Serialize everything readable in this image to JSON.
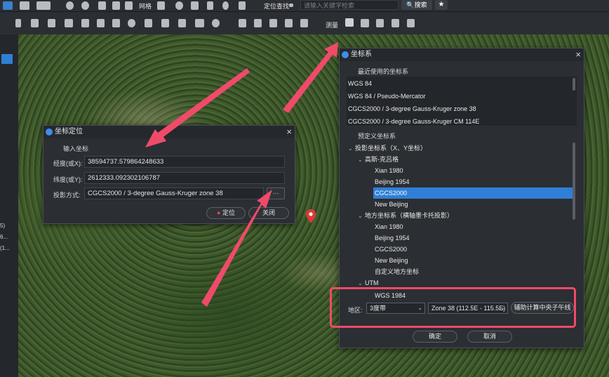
{
  "toolbar": {
    "grid_label": "网格",
    "locate_search_label": "定位查找",
    "search_placeholder": "请输入关键字检索",
    "search_button": "搜索",
    "measure_label": "测量",
    "star_button": "★"
  },
  "left_panel": {
    "labels": [
      "5)",
      "6...",
      "(1..."
    ]
  },
  "coord_locate_dialog": {
    "title": "坐标定位",
    "section_title": "输入坐标",
    "longitude_label": "经度(或X):",
    "longitude_value": "38594737.579864248633",
    "latitude_label": "纬度(或Y):",
    "latitude_value": "2612333.092302106787",
    "projection_label": "投影方式:",
    "projection_value": "CGCS2000 / 3-degree Gauss-Kruger zone 38",
    "browse_button": "···",
    "locate_button": "定位",
    "close_button": "关闭"
  },
  "crs_dialog": {
    "title": "坐标系",
    "recent_header": "最近使用的坐标系",
    "recent_items": [
      "WGS 84",
      "WGS 84 / Pseudo-Mercator",
      "CGCS2000 / 3-degree Gauss-Kruger zone 38",
      "CGCS2000 / 3-degree Gauss-Kruger CM 114E"
    ],
    "predefined_header": "预定义坐标系",
    "tree": {
      "projected": "投影坐标系（X、Y坐标）",
      "gauss": "高斯-克吕格",
      "gauss_children": [
        "Xian 1980",
        "Beijing 1954",
        "CGCS2000",
        "New Beijing"
      ],
      "gauss_selected": "CGCS2000",
      "local": "地方坐标系（横轴墨卡托投影）",
      "local_children": [
        "Xian 1980",
        "Beijing 1954",
        "CGCS2000",
        "New Beijing",
        "自定义地方坐标"
      ],
      "utm": "UTM",
      "utm_child": "WGS 1984"
    },
    "region_label": "地区:",
    "band_value": "3度带",
    "zone_value": "Zone 38 (112.5E - 115.5E)",
    "calc_button": "辅助计算中央子午线",
    "ok_button": "确定",
    "cancel_button": "取消"
  },
  "colors": {
    "accent": "#2f7fd6",
    "annotation": "#f04a6a",
    "pin": "#d93a3a"
  }
}
